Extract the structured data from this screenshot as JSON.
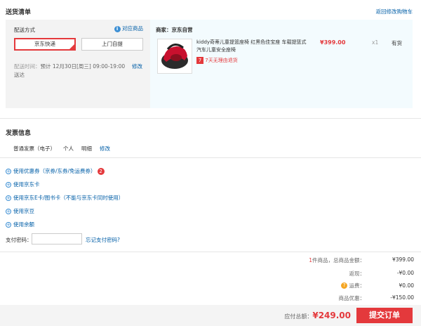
{
  "shipping": {
    "title": "送货清单",
    "back_link": "返回修改购物车",
    "method_label": "配送方式",
    "method_help": "对应商品",
    "option_jd": "京东快递",
    "option_pickup": "上门自提",
    "time_label": "配送时间：",
    "time_value": "预计 12月30日[周三] 09:00-19:00 送达",
    "time_edit": "修改"
  },
  "goods": {
    "seller": "商家：京东自营",
    "name": "kiddy奇蒂儿童提篮座椅 红黑色佳宝座 车载提篮式汽车儿童安全座椅",
    "price": "¥399.00",
    "qty": "x1",
    "stock": "有货",
    "return_badge": "7",
    "return_text": "7天无理由退货"
  },
  "invoice": {
    "title": "发票信息",
    "type": "普通发票（电子）",
    "holder": "个人",
    "content": "明细",
    "edit": "修改"
  },
  "payment_options": [
    {
      "label": "使用优惠券（京券/东券/免运费券）",
      "badge": "2"
    },
    {
      "label": "使用京东卡"
    },
    {
      "label": "使用京东E卡/图书卡（不能与京东卡同时使用）"
    },
    {
      "label": "使用京豆"
    },
    {
      "label": "使用余额"
    }
  ],
  "pay_password": {
    "label": "支付密码：",
    "forgot": "忘记支付密码?"
  },
  "summary": {
    "count_prefix": "1",
    "count_label": "件商品，总商品金额：",
    "total_goods": "¥399.00",
    "rebate_label": "返现：",
    "rebate": "-¥0.00",
    "freight_label": "运费：",
    "freight": "¥0.00",
    "discount_label": "商品优惠：",
    "discount": "-¥150.00"
  },
  "footer": {
    "payable_label": "应付总额：",
    "payable": "¥249.00",
    "submit": "提交订单"
  },
  "colors": {
    "accent": "#e4393c",
    "link": "#005ea7"
  }
}
